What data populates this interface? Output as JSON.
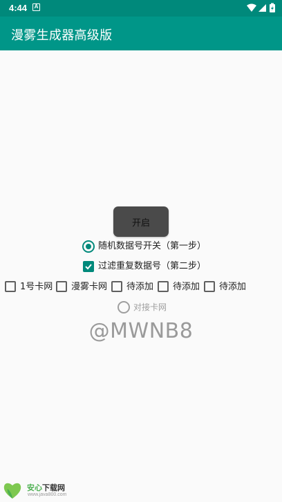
{
  "status_bar": {
    "time": "4:44",
    "notification_glyph": "A",
    "icons": [
      "wifi-icon",
      "signal-icon",
      "battery-charging-icon"
    ]
  },
  "app_bar": {
    "title": "漫雾生成器高级版"
  },
  "main": {
    "start_button_label": "开启",
    "options": [
      {
        "label": "随机数据号开关（第一步）",
        "type": "radio",
        "checked": true
      },
      {
        "label": "过滤重复数据号（第二步）",
        "type": "checkbox",
        "checked": true
      }
    ],
    "channels": [
      {
        "label": "1号卡网",
        "checked": false
      },
      {
        "label": "漫雾卡网",
        "checked": false
      },
      {
        "label": "待添加",
        "checked": false
      },
      {
        "label": "待添加",
        "checked": false
      },
      {
        "label": "待添加",
        "checked": false
      }
    ],
    "dock_option": {
      "label": "对接卡网",
      "checked": false,
      "enabled": false
    },
    "handle": "@MWNB8"
  },
  "source_watermark": {
    "title_green": "安心",
    "title_dark": "下载网",
    "url": "www.java800.com"
  },
  "colors": {
    "primary": "#009688",
    "primary_dark": "#00897b",
    "button": "#4a4a4a",
    "background": "#fafafa"
  }
}
